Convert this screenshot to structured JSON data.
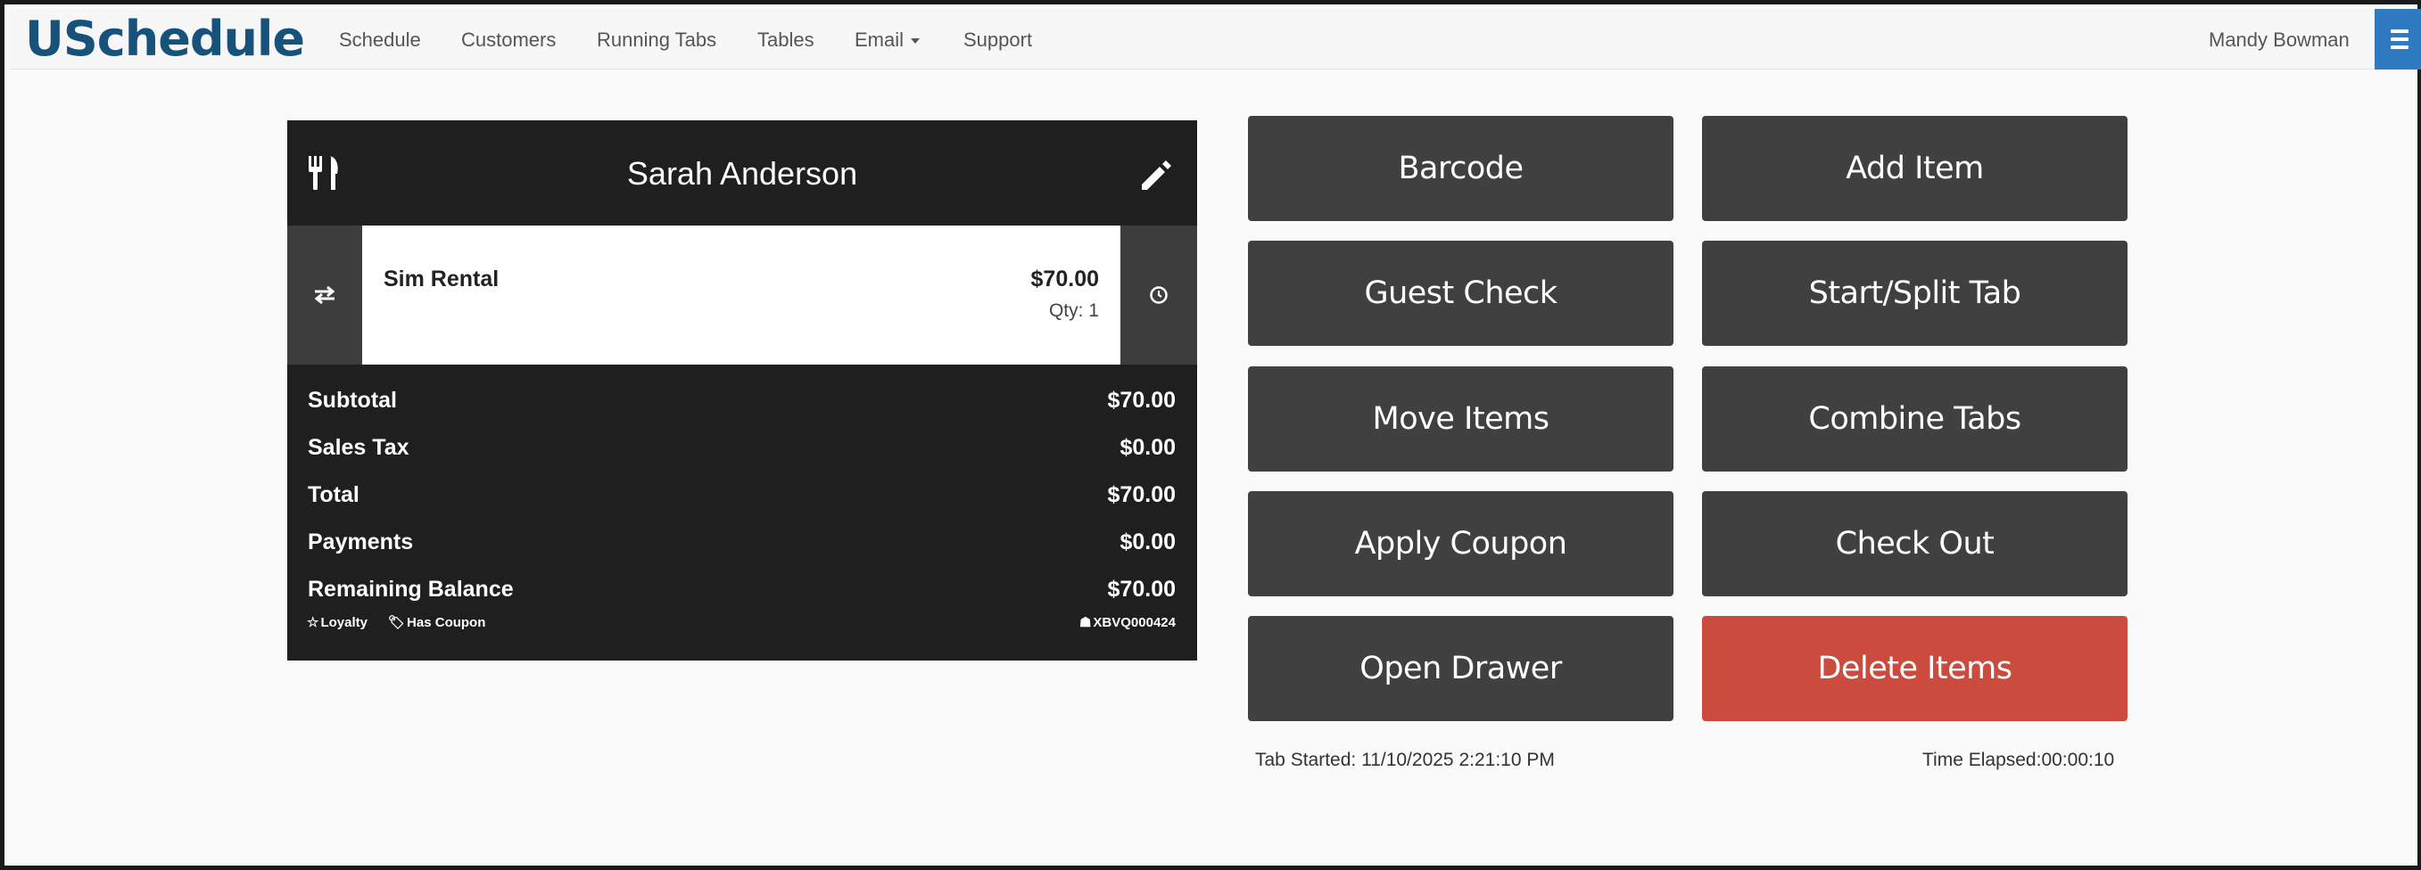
{
  "navbar": {
    "brand": "USchedule",
    "links": [
      {
        "label": "Schedule"
      },
      {
        "label": "Customers"
      },
      {
        "label": "Running Tabs"
      },
      {
        "label": "Tables"
      },
      {
        "label": "Email"
      },
      {
        "label": "Support"
      }
    ],
    "user": "Mandy Bowman",
    "accent_color": "#2f7ac1",
    "brand_color": "#17527a"
  },
  "tab": {
    "customer_name": "Sarah Anderson",
    "items": [
      {
        "name": "Sim Rental",
        "price": "$70.00",
        "qty": "Qty: 1"
      }
    ],
    "totals": [
      {
        "label": "Subtotal",
        "value": "$70.00"
      },
      {
        "label": "Sales Tax",
        "value": "$0.00"
      },
      {
        "label": "Total",
        "value": "$70.00"
      },
      {
        "label": "Payments",
        "value": "$0.00"
      },
      {
        "label": "Remaining Balance",
        "value": "$70.00"
      }
    ],
    "badges": {
      "loyalty": "Loyalty",
      "coupon": "Has Coupon",
      "code": "XBVQ000424"
    },
    "icons": {
      "header_left": "fork-knife-icon",
      "header_right": "pencil-icon",
      "row_left": "swap-icon",
      "row_right": "clock-icon"
    }
  },
  "actions": {
    "barcode": "Barcode",
    "add_item": "Add Item",
    "guest_check": "Guest Check",
    "start_split": "Start/Split Tab",
    "move_items": "Move Items",
    "combine_tabs": "Combine Tabs",
    "apply_coupon": "Apply Coupon",
    "check_out": "Check Out",
    "open_drawer": "Open Drawer",
    "delete_items": "Delete Items",
    "button_color": "#404040",
    "danger_color": "#cc4b3f"
  },
  "footer": {
    "tab_started": "Tab Started: 11/10/2025 2:21:10 PM",
    "time_elapsed": "Time Elapsed:00:00:10"
  }
}
